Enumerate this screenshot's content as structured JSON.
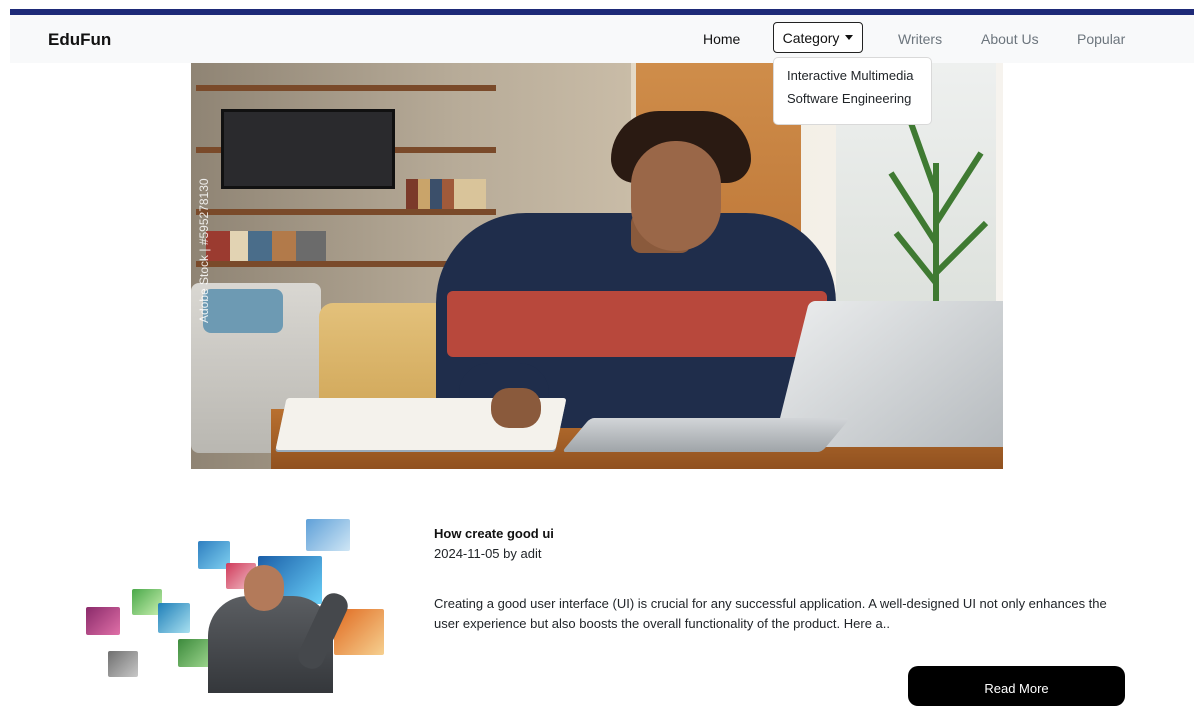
{
  "navbar": {
    "brand": "EduFun",
    "links": {
      "home": "Home",
      "category": "Category",
      "writers": "Writers",
      "about": "About Us",
      "popular": "Popular"
    },
    "dropdown": [
      "Interactive Multimedia",
      "Software Engineering"
    ]
  },
  "hero": {
    "watermark": "Adobe Stock | #595278130"
  },
  "article": {
    "title": "How create good ui",
    "meta": "2024-11-05 by adit",
    "excerpt": "Creating a good user interface (UI) is crucial for any successful application. A well-designed UI not only enhances the user experience but also boosts the overall functionality of the product. Here a..",
    "button": "Read More"
  },
  "icons": {
    "caret": "caret-down-icon"
  },
  "colors": {
    "topbar": "#1e2a78",
    "navbar_bg": "#f8f9fa",
    "button": "#000000"
  }
}
